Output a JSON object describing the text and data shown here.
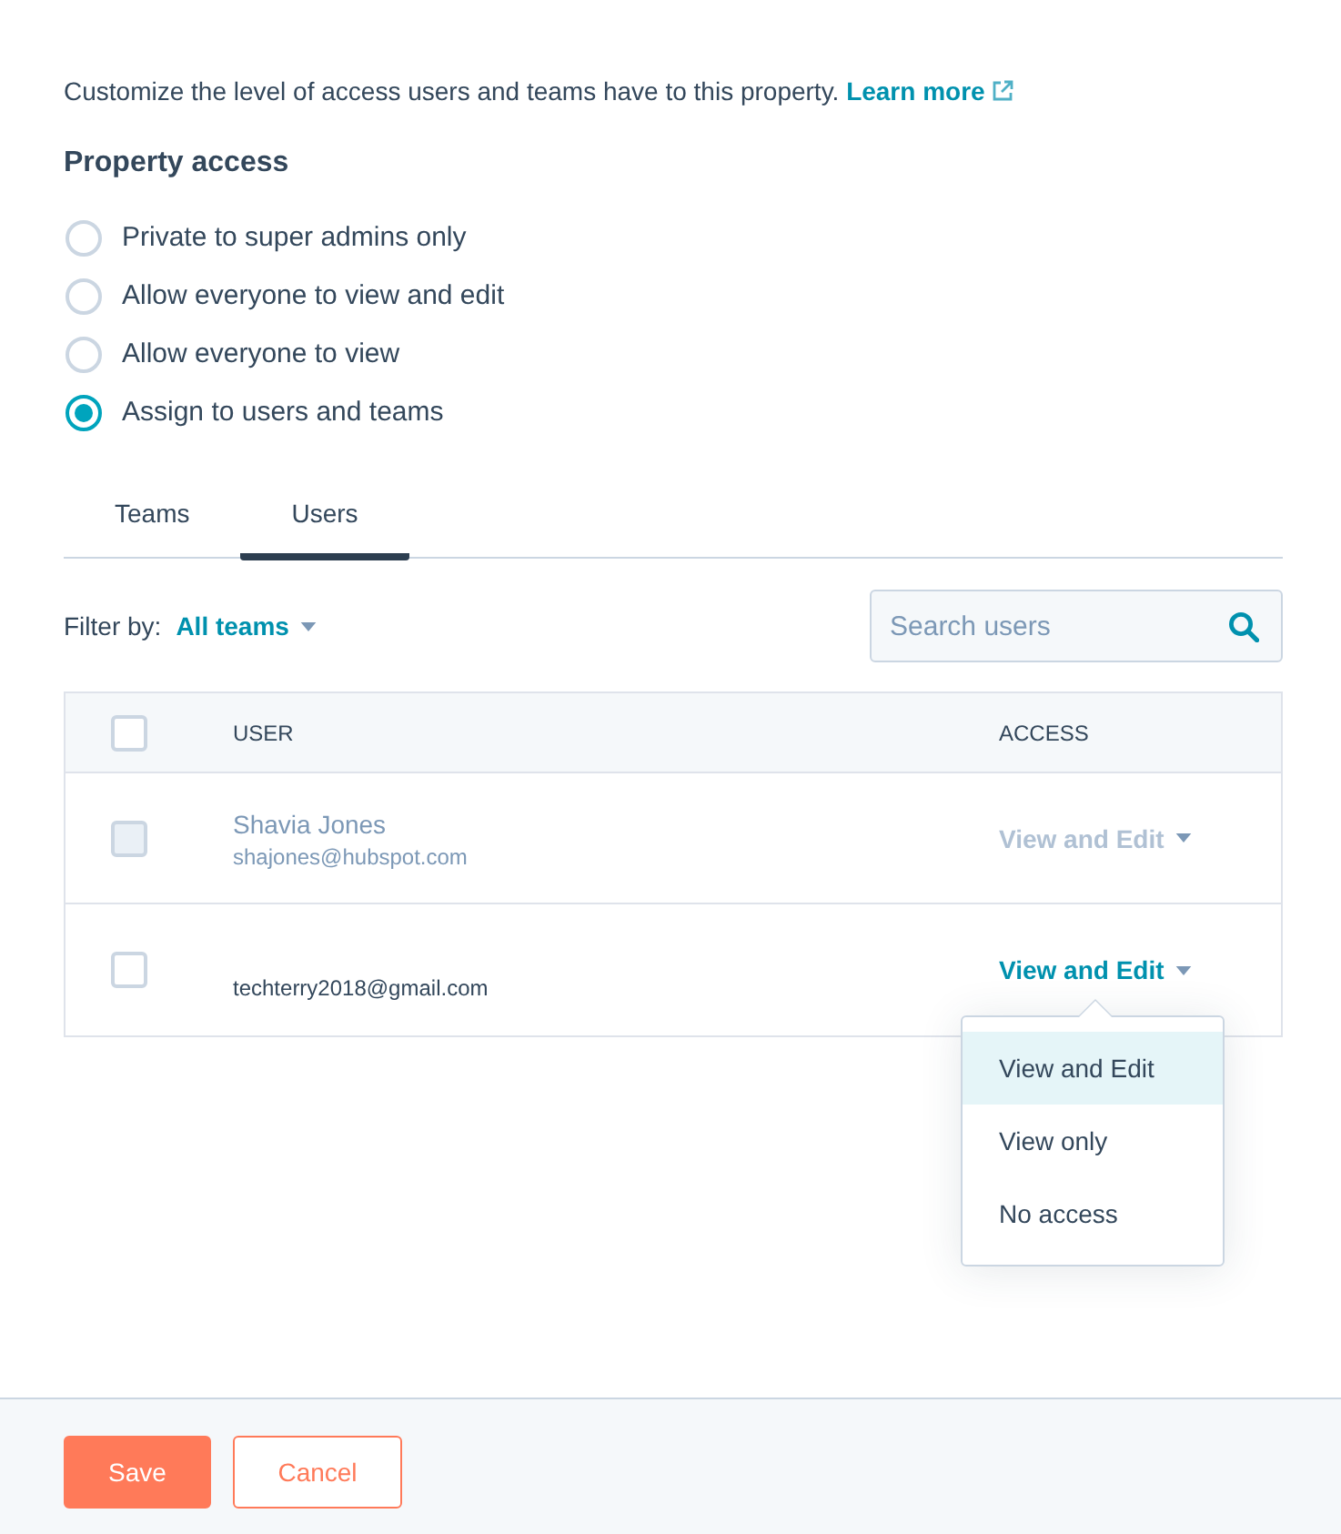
{
  "intro": {
    "text": "Customize the level of access users and teams have to this property.",
    "link": "Learn more"
  },
  "property_access": {
    "title": "Property access",
    "options": [
      {
        "label": "Private to super admins only",
        "selected": false
      },
      {
        "label": "Allow everyone to view and edit",
        "selected": false
      },
      {
        "label": "Allow everyone to view",
        "selected": false
      },
      {
        "label": "Assign to users and teams",
        "selected": true
      }
    ]
  },
  "tabs": [
    {
      "label": "Teams",
      "selected": false
    },
    {
      "label": "Users",
      "selected": true
    }
  ],
  "filter": {
    "label": "Filter by:",
    "value": "All teams"
  },
  "search": {
    "placeholder": "Search users"
  },
  "table": {
    "select_all": {
      "checked": false
    },
    "columns": [
      "USER",
      "ACCESS"
    ],
    "rows": [
      {
        "name": "Shavia Jones",
        "email": "shajones@hubspot.com",
        "access": "View and Edit",
        "checked": false,
        "disabled": true
      },
      {
        "email": "techterry2018@gmail.com",
        "access": "View and Edit",
        "checked": false,
        "disabled": false,
        "menu": [
          {
            "label": "View and Edit",
            "selected": true
          },
          {
            "label": "View only",
            "selected": false
          },
          {
            "label": "No access",
            "selected": false
          }
        ]
      }
    ]
  },
  "buttons": [
    {
      "label": "Save",
      "kind": "primary"
    },
    {
      "label": "Cancel",
      "kind": "secondary"
    }
  ]
}
